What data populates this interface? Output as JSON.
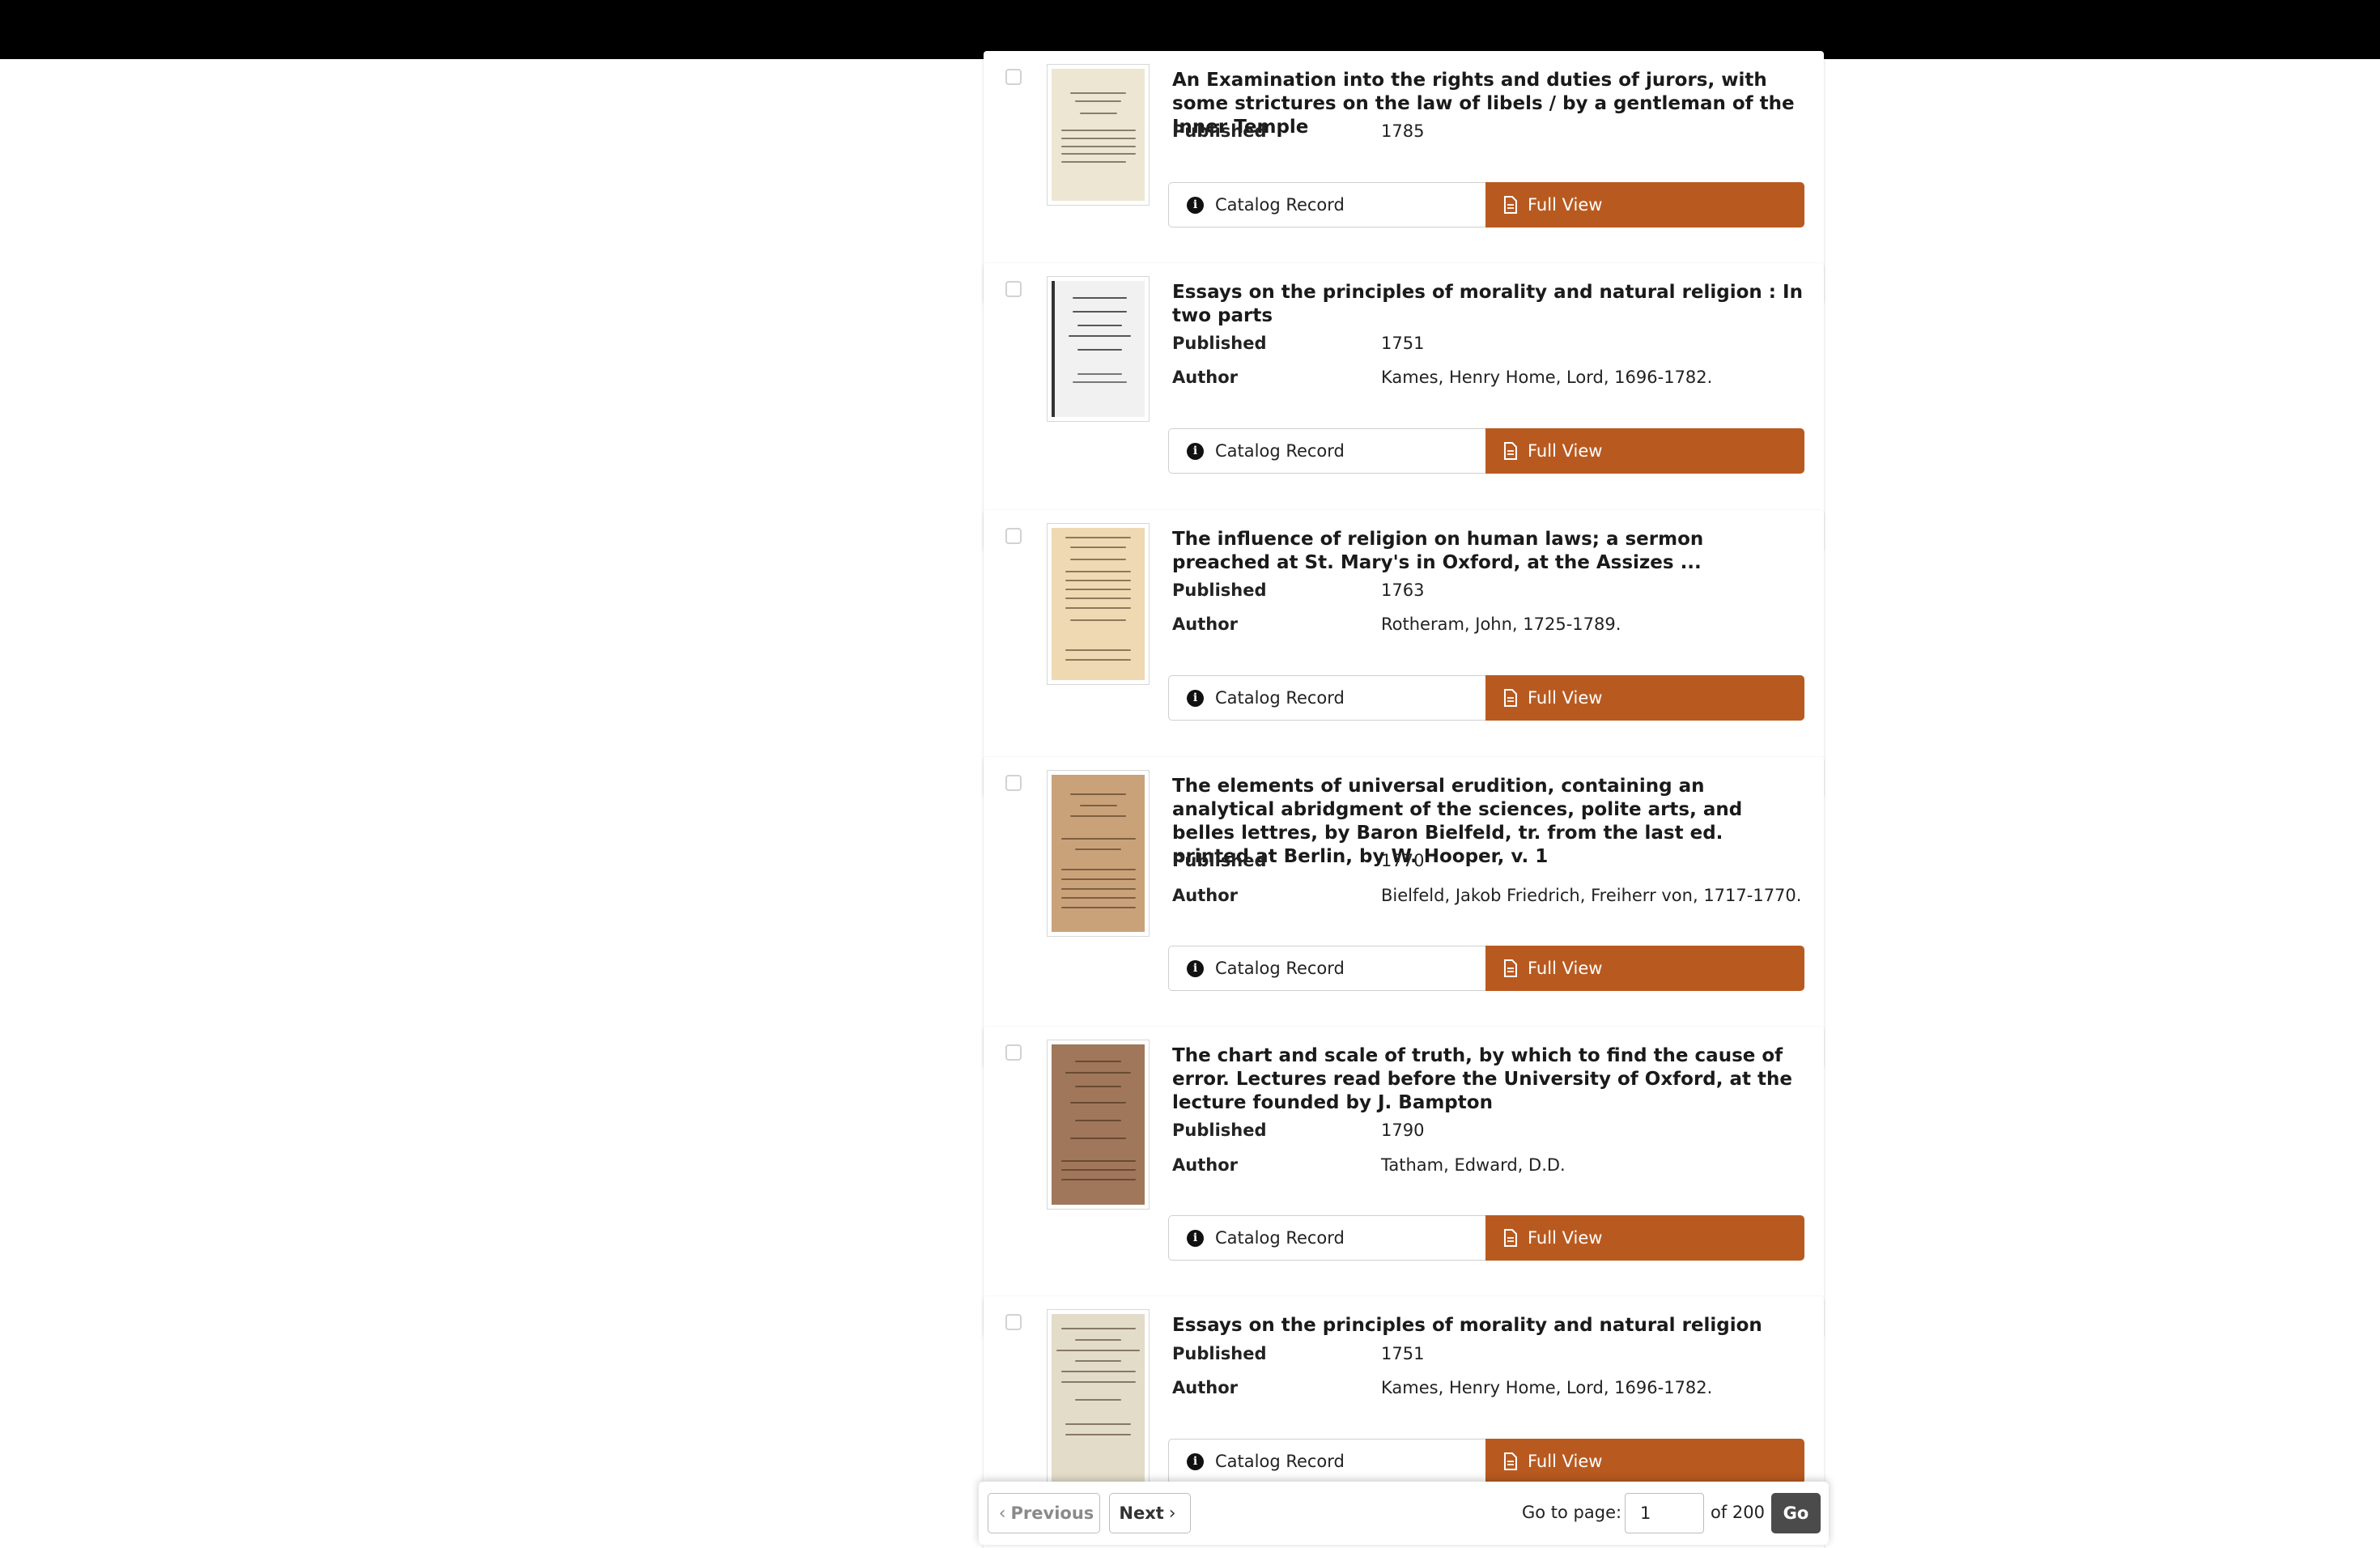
{
  "results": [
    {
      "title": "An Examination into the rights and duties of jurors, with some strictures on the law of libels / by a gentleman of the Inner Temple",
      "published_label": "Published",
      "published": "1785",
      "catalog_label": "Catalog Record",
      "full_view_label": "Full View"
    },
    {
      "title": "Essays on the principles of morality and natural religion : In two parts",
      "published_label": "Published",
      "published": "1751",
      "author_label": "Author",
      "author": "Kames, Henry Home, Lord, 1696-1782.",
      "catalog_label": "Catalog Record",
      "full_view_label": "Full View"
    },
    {
      "title": "The influence of religion on human laws; a sermon preached at St. Mary's in Oxford, at the Assizes ...",
      "published_label": "Published",
      "published": "1763",
      "author_label": "Author",
      "author": "Rotheram, John, 1725-1789.",
      "catalog_label": "Catalog Record",
      "full_view_label": "Full View"
    },
    {
      "title": "The elements of universal erudition, containing an analytical abridgment of the sciences, polite arts, and belles lettres, by Baron Bielfeld, tr. from the last ed. printed at Berlin, by W. Hooper, v. 1",
      "published_label": "Published",
      "published": "1770",
      "author_label": "Author",
      "author": "Bielfeld, Jakob Friedrich, Freiherr von, 1717-1770.",
      "catalog_label": "Catalog Record",
      "full_view_label": "Full View"
    },
    {
      "title": "The chart and scale of truth, by which to find the cause of error. Lectures read before the University of Oxford, at the lecture founded by J. Bampton",
      "published_label": "Published",
      "published": "1790",
      "author_label": "Author",
      "author": "Tatham, Edward, D.D.",
      "catalog_label": "Catalog Record",
      "full_view_label": "Full View"
    },
    {
      "title": "Essays on the principles of morality and natural religion",
      "published_label": "Published",
      "published": "1751",
      "author_label": "Author",
      "author": "Kames, Henry Home, Lord, 1696-1782.",
      "catalog_label": "Catalog Record",
      "full_view_label": "Full View"
    }
  ],
  "pager": {
    "previous_label": "Previous",
    "next_label": "Next",
    "goto_label": "Go to page:",
    "page_value": "1",
    "of_label": "of 200",
    "go_label": "Go"
  },
  "colors": {
    "accent": "#b85a20",
    "topbar": "#000000",
    "go_button": "#4b4b4b"
  },
  "icons": {
    "info": "info-circle-icon",
    "document": "document-icon",
    "chevron_left": "chevron-left-icon",
    "chevron_right": "chevron-right-icon"
  }
}
